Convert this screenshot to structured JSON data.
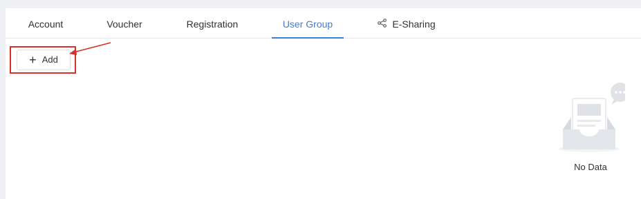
{
  "tabs": [
    {
      "label": "Account",
      "active": false
    },
    {
      "label": "Voucher",
      "active": false
    },
    {
      "label": "Registration",
      "active": false
    },
    {
      "label": "User Group",
      "active": true
    },
    {
      "label": "E-Sharing",
      "active": false,
      "icon": "share-icon"
    }
  ],
  "toolbar": {
    "add_label": "Add",
    "add_icon": "plus-icon"
  },
  "annotation": {
    "highlight_color": "#d93025"
  },
  "empty_state": {
    "label": "No Data",
    "icon": "empty-inbox-icon"
  },
  "colors": {
    "accent": "#3a7be0",
    "background": "#eef0f3"
  }
}
